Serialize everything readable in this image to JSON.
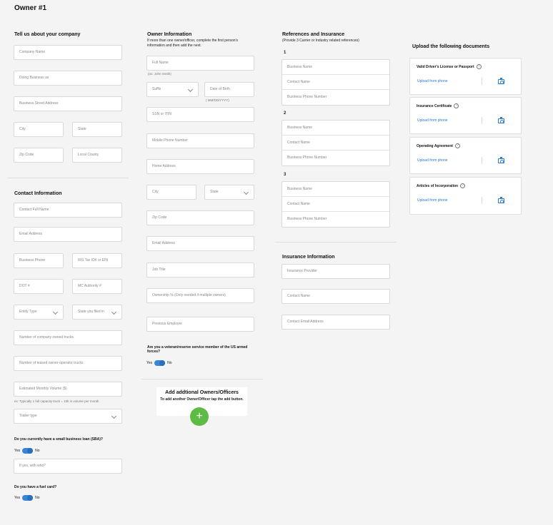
{
  "page_title": "Owner #1",
  "company": {
    "heading": "Tell us about your company",
    "company_name": "Company Name",
    "dba": "Doing Business as",
    "street": "Business Street Address",
    "city": "City",
    "state": "State",
    "zip": "Zip Code",
    "county": "Local County"
  },
  "contact": {
    "heading": "Contact Information",
    "full_name": "Contact Full Name",
    "email": "Email Address",
    "phone": "Business Phone",
    "tax_id": "IRS Tax ID# or EIN",
    "dot": "DOT #",
    "mc": "MC Authority #",
    "entity": "Entity Type",
    "state_filed": "State you filed in",
    "owned_trucks": "Number of company owned trucks",
    "leased_trucks": "Number of leased owner-operator trucks",
    "monthly_volume": "Estimated Monthly Volume ($)",
    "volume_hint": "ex: Typically 1 full capacity truck = 10k in volume per month",
    "trailer": "Trailer type",
    "sba_question": "Do you currently have a small business loan (SBA)?",
    "sba_yes": "Yes",
    "sba_no": "No",
    "sba_with": "If yes, with who?",
    "fuel_question": "Do you have a fuel card?",
    "fuel_yes": "Yes",
    "fuel_no": "No"
  },
  "owner": {
    "heading": "Owner Information",
    "subtitle": "If more than one owner/officer, complete the first person's information and then add the next.",
    "full_name": "Full Name",
    "full_name_hint": "(ex: John Smith)",
    "suffix": "Suffix",
    "dob": "Date of Birth",
    "dob_hint": "( MM/DD/YYYY)",
    "ssn": "SSN or ITIN",
    "mobile": "Mobile Phone Number",
    "home": "Home Address",
    "city": "City",
    "state": "State",
    "zip": "Zip Code",
    "email": "Email Address",
    "job": "Job Title",
    "ownership": "Ownership %  (Only needed if multiple owners)",
    "employer": "Previous Employer",
    "veteran_question": "Are you a veteran/reserve service member of the US armed forces?",
    "vet_yes": "Yes",
    "vet_no": "No",
    "add_title": "Add addtional Owners/Officers",
    "add_sub": "To add another Owner/Officer tap the add button.",
    "add_button": "+"
  },
  "references": {
    "heading": "References and Insurance",
    "subtitle": "(Provide 3 Carrier or Industry related references)",
    "groups": [
      {
        "num": "1",
        "name": "Business Name",
        "contact": "Contact Name",
        "phone": "Business Phone Number"
      },
      {
        "num": "2",
        "name": "Business Name",
        "contact": "Contact Name",
        "phone": "Business Phone Number"
      },
      {
        "num": "3",
        "name": "Business Name",
        "contact": "Contact Name",
        "phone": "Business Phone Number"
      }
    ],
    "insurance_heading": "Insurance Information",
    "provider": "Insurance Provider",
    "contact_name": "Contact Name",
    "contact_email": "Contact Email Address"
  },
  "documents": {
    "heading": "Upload the following documents",
    "items": [
      {
        "title": "Valid Driver's License or Passport",
        "action": "Upload from phone"
      },
      {
        "title": "Insurance Certificate",
        "action": "Upload from phone"
      },
      {
        "title": "Operating Agreement",
        "action": "Upload from phone"
      },
      {
        "title": "Articles of Incorporation",
        "action": "Upload from phone"
      }
    ],
    "help_glyph": "?"
  }
}
